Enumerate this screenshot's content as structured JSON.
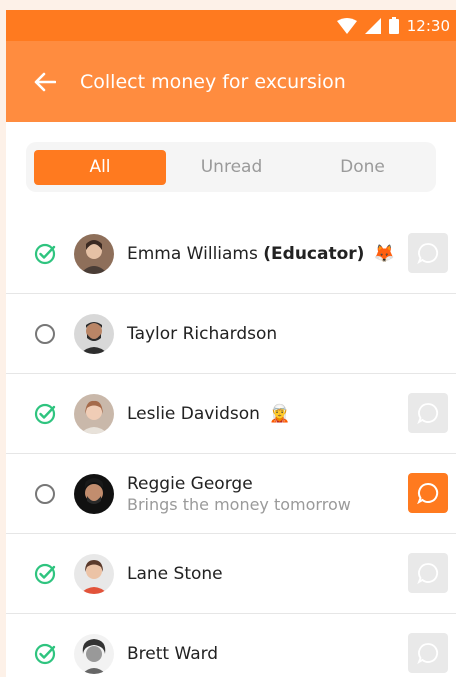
{
  "status_bar": {
    "time": "12:30"
  },
  "header": {
    "title": "Collect money for excursion"
  },
  "tabs": [
    {
      "label": "All",
      "active": true
    },
    {
      "label": "Unread",
      "active": false
    },
    {
      "label": "Done",
      "active": false
    }
  ],
  "people": [
    {
      "name": "Emma Williams",
      "role": "(Educator)",
      "emoji": "🦊",
      "status": "done",
      "subtitle": "",
      "has_message": true,
      "message_active": false
    },
    {
      "name": "Taylor Richardson",
      "role": "",
      "emoji": "",
      "status": "pending",
      "subtitle": "",
      "has_message": false,
      "message_active": false
    },
    {
      "name": "Leslie Davidson",
      "role": "",
      "emoji": "🧝",
      "status": "done",
      "subtitle": "",
      "has_message": true,
      "message_active": false
    },
    {
      "name": "Reggie George",
      "role": "",
      "emoji": "",
      "status": "pending",
      "subtitle": "Brings the money tomorrow",
      "has_message": true,
      "message_active": true
    },
    {
      "name": "Lane Stone",
      "role": "",
      "emoji": "",
      "status": "done",
      "subtitle": "",
      "has_message": true,
      "message_active": false
    },
    {
      "name": "Brett Ward",
      "role": "",
      "emoji": "",
      "status": "done",
      "subtitle": "",
      "has_message": true,
      "message_active": false
    }
  ],
  "colors": {
    "accent": "#ff7a1f",
    "header": "#ff8c3f",
    "check": "#2fc47f",
    "inactive": "#9a9a9a"
  },
  "icons": {
    "back": "arrow-left-icon",
    "done": "check-circle-icon",
    "pending": "empty-circle-icon",
    "message": "chat-bubble-icon"
  }
}
